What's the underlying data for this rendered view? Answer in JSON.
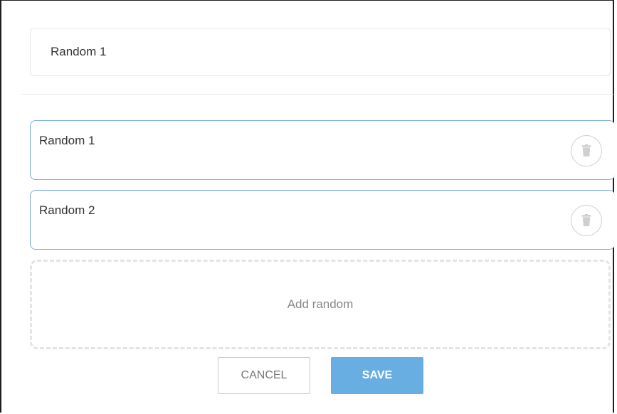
{
  "name_field": {
    "value": "Random 1"
  },
  "items": [
    {
      "label": "Random 1",
      "delete_icon": "trash-icon"
    },
    {
      "label": "Random 2",
      "delete_icon": "trash-icon"
    }
  ],
  "add": {
    "label": "Add random"
  },
  "actions": {
    "cancel_label": "CANCEL",
    "save_label": "SAVE"
  },
  "colors": {
    "accent": "#69aee3",
    "item_border": "#77aadf"
  }
}
